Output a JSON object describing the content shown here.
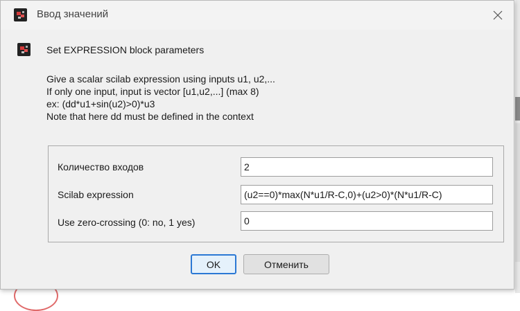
{
  "window": {
    "title": "Ввод значений",
    "icon": "scilab-app-icon"
  },
  "header": {
    "title": "Set EXPRESSION block parameters"
  },
  "description": {
    "lines": [
      "Give a scalar scilab expression using inputs u1, u2,...",
      "If only one input, input is vector [u1,u2,...] (max 8)",
      "ex: (dd*u1+sin(u2)>0)*u3",
      "Note that here dd must be defined in the context"
    ]
  },
  "form": {
    "fields": [
      {
        "label": "Количество входов",
        "value": "2"
      },
      {
        "label": "Scilab expression",
        "value": "(u2==0)*max(N*u1/R-C,0)+(u2>0)*(N*u1/R-C)"
      },
      {
        "label": "Use zero-crossing (0: no, 1 yes)",
        "value": "0"
      }
    ]
  },
  "buttons": {
    "ok_label": "OK",
    "cancel_label": "Отменить"
  },
  "colors": {
    "dialog_bg": "#f0f0f0",
    "focus_border": "#2b78d4"
  }
}
